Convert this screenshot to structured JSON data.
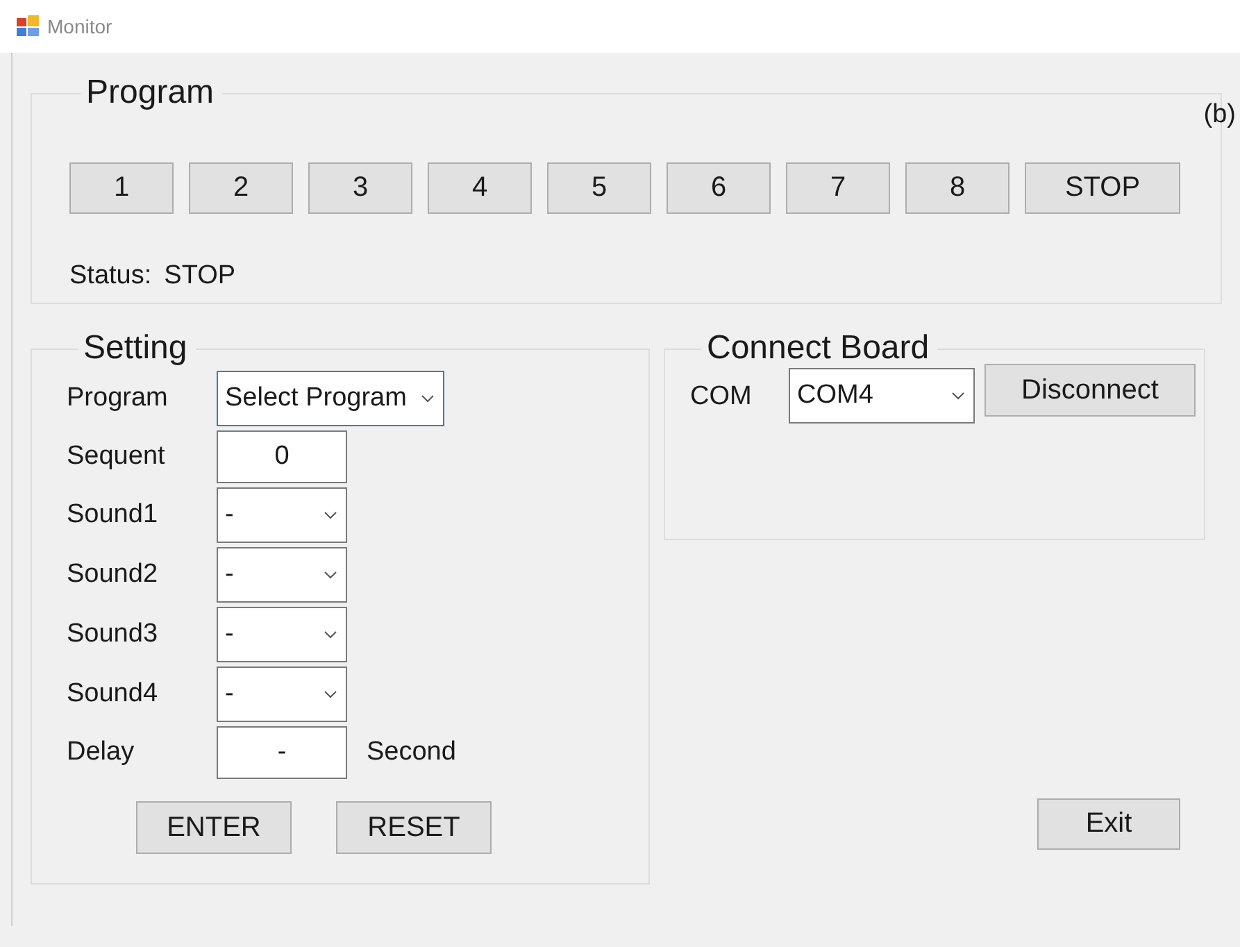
{
  "window": {
    "title": "Monitor"
  },
  "figure_label": "(b)",
  "program": {
    "title": "Program",
    "buttons": [
      "1",
      "2",
      "3",
      "4",
      "5",
      "6",
      "7",
      "8",
      "STOP"
    ],
    "status_label": "Status:",
    "status_value": "STOP"
  },
  "setting": {
    "title": "Setting",
    "rows": [
      {
        "kind": "dropdown",
        "label": "Program",
        "value": "Select Program",
        "focused": true
      },
      {
        "kind": "textbox",
        "label": "Sequent",
        "value": "0"
      },
      {
        "kind": "dropdown",
        "label": "Sound1",
        "value": "-",
        "focused": false
      },
      {
        "kind": "dropdown",
        "label": "Sound2",
        "value": "-",
        "focused": false
      },
      {
        "kind": "dropdown",
        "label": "Sound3",
        "value": "-",
        "focused": false
      },
      {
        "kind": "dropdown",
        "label": "Sound4",
        "value": "-",
        "focused": false
      },
      {
        "kind": "textbox",
        "label": "Delay",
        "value": "-",
        "unit": "Second"
      }
    ],
    "buttons": [
      "ENTER",
      "RESET"
    ]
  },
  "connect": {
    "title": "Connect Board",
    "label": "COM",
    "port": "COM4",
    "button": "Disconnect"
  },
  "exit_button": "Exit"
}
